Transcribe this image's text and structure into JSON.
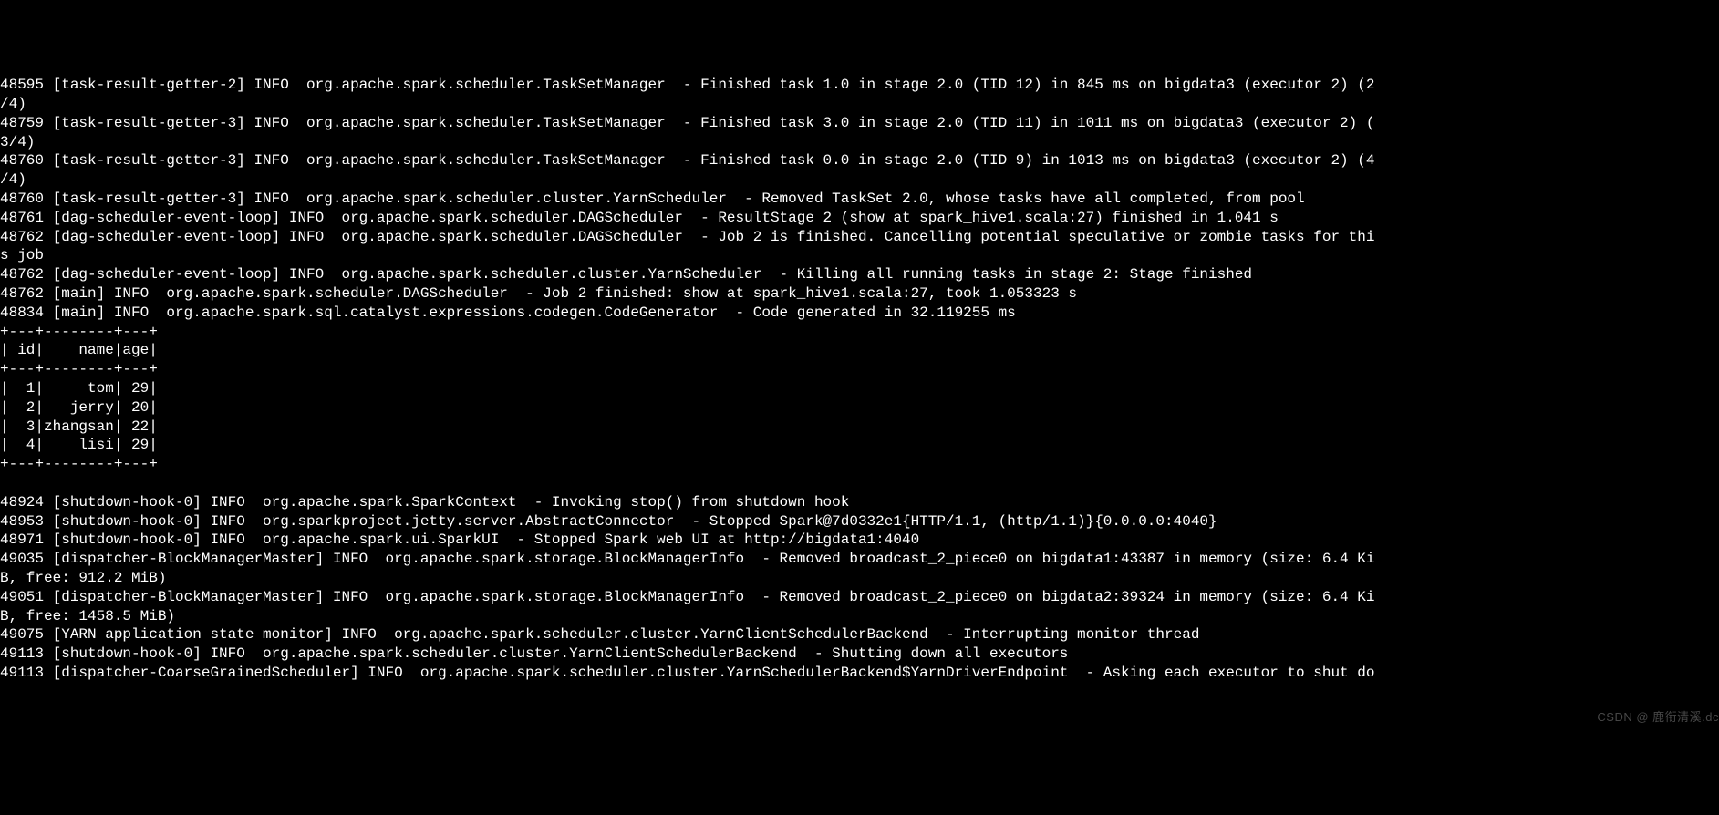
{
  "lines": [
    "48595 [task-result-getter-2] INFO  org.apache.spark.scheduler.TaskSetManager  - Finished task 1.0 in stage 2.0 (TID 12) in 845 ms on bigdata3 (executor 2) (2",
    "/4)",
    "48759 [task-result-getter-3] INFO  org.apache.spark.scheduler.TaskSetManager  - Finished task 3.0 in stage 2.0 (TID 11) in 1011 ms on bigdata3 (executor 2) (",
    "3/4)",
    "48760 [task-result-getter-3] INFO  org.apache.spark.scheduler.TaskSetManager  - Finished task 0.0 in stage 2.0 (TID 9) in 1013 ms on bigdata3 (executor 2) (4",
    "/4)",
    "48760 [task-result-getter-3] INFO  org.apache.spark.scheduler.cluster.YarnScheduler  - Removed TaskSet 2.0, whose tasks have all completed, from pool",
    "48761 [dag-scheduler-event-loop] INFO  org.apache.spark.scheduler.DAGScheduler  - ResultStage 2 (show at spark_hive1.scala:27) finished in 1.041 s",
    "48762 [dag-scheduler-event-loop] INFO  org.apache.spark.scheduler.DAGScheduler  - Job 2 is finished. Cancelling potential speculative or zombie tasks for thi",
    "s job",
    "48762 [dag-scheduler-event-loop] INFO  org.apache.spark.scheduler.cluster.YarnScheduler  - Killing all running tasks in stage 2: Stage finished",
    "48762 [main] INFO  org.apache.spark.scheduler.DAGScheduler  - Job 2 finished: show at spark_hive1.scala:27, took 1.053323 s",
    "48834 [main] INFO  org.apache.spark.sql.catalyst.expressions.codegen.CodeGenerator  - Code generated in 32.119255 ms",
    "+---+--------+---+",
    "| id|    name|age|",
    "+---+--------+---+",
    "|  1|     tom| 29|",
    "|  2|   jerry| 20|",
    "|  3|zhangsan| 22|",
    "|  4|    lisi| 29|",
    "+---+--------+---+",
    "",
    "48924 [shutdown-hook-0] INFO  org.apache.spark.SparkContext  - Invoking stop() from shutdown hook",
    "48953 [shutdown-hook-0] INFO  org.sparkproject.jetty.server.AbstractConnector  - Stopped Spark@7d0332e1{HTTP/1.1, (http/1.1)}{0.0.0.0:4040}",
    "48971 [shutdown-hook-0] INFO  org.apache.spark.ui.SparkUI  - Stopped Spark web UI at http://bigdata1:4040",
    "49035 [dispatcher-BlockManagerMaster] INFO  org.apache.spark.storage.BlockManagerInfo  - Removed broadcast_2_piece0 on bigdata1:43387 in memory (size: 6.4 Ki",
    "B, free: 912.2 MiB)",
    "49051 [dispatcher-BlockManagerMaster] INFO  org.apache.spark.storage.BlockManagerInfo  - Removed broadcast_2_piece0 on bigdata2:39324 in memory (size: 6.4 Ki",
    "B, free: 1458.5 MiB)",
    "49075 [YARN application state monitor] INFO  org.apache.spark.scheduler.cluster.YarnClientSchedulerBackend  - Interrupting monitor thread",
    "49113 [shutdown-hook-0] INFO  org.apache.spark.scheduler.cluster.YarnClientSchedulerBackend  - Shutting down all executors",
    "49113 [dispatcher-CoarseGrainedScheduler] INFO  org.apache.spark.scheduler.cluster.YarnSchedulerBackend$YarnDriverEndpoint  - Asking each executor to shut do"
  ],
  "watermark": "CSDN @ 鹿衔清溪.dc",
  "chart_data": {
    "type": "table",
    "title": "",
    "columns": [
      "id",
      "name",
      "age"
    ],
    "rows": [
      {
        "id": 1,
        "name": "tom",
        "age": 29
      },
      {
        "id": 2,
        "name": "jerry",
        "age": 20
      },
      {
        "id": 3,
        "name": "zhangsan",
        "age": 22
      },
      {
        "id": 4,
        "name": "lisi",
        "age": 29
      }
    ]
  }
}
